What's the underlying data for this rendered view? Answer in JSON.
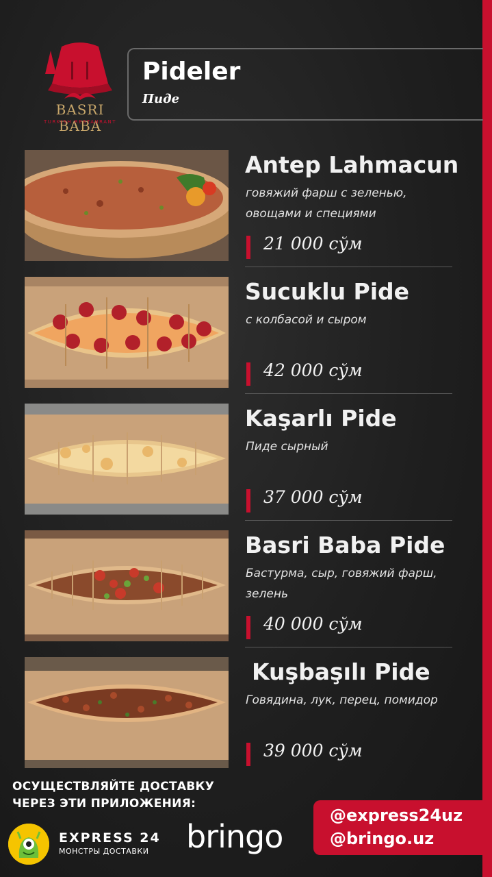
{
  "header": {
    "logo_name": "BASRI BABA",
    "logo_subtitle": "TURKISH RESTAURANT",
    "title": "Pideler",
    "subtitle": "Пиде"
  },
  "items": [
    {
      "name": "Antep Lahmacun",
      "description": "говяжий фарш с зеленью, овощами и специями",
      "price": "21 000 сўм",
      "photo_icon": "lahmacun-photo"
    },
    {
      "name": "Sucuklu Pide",
      "description": "с колбасой и сыром",
      "price": "42 000 сўм",
      "photo_icon": "sucuklu-pide-photo"
    },
    {
      "name": "Kaşarlı Pide",
      "description": "Пиде сырный",
      "price": "37 000 сўм",
      "photo_icon": "kasarli-pide-photo"
    },
    {
      "name": "Basri Baba Pide",
      "description": "Бастурма, сыр, говяжий фарш, зелень",
      "price": "40 000 сўм",
      "photo_icon": "basri-baba-pide-photo"
    },
    {
      "name": "Kuşbaşılı Pide",
      "description": "Говядина, лук, перец, помидор",
      "price": "39 000 сўм",
      "photo_icon": "kusbasili-pide-photo"
    }
  ],
  "footer": {
    "delivery_line1": "ОСУЩЕСТВЛЯЙТЕ ДОСТАВКУ",
    "delivery_line2": "ЧЕРЕЗ ЭТИ ПРИЛОЖЕНИЯ:",
    "express_name": "EXPRESS 24",
    "express_tagline": "МОНСТРЫ ДОСТАВКИ",
    "bringo_name": "bringo",
    "handle_express": "@express24uz",
    "handle_bringo": "@bringo.uz"
  },
  "colors": {
    "accent": "#c8102e",
    "background": "#1f1f1f",
    "gold": "#c7a66a"
  }
}
